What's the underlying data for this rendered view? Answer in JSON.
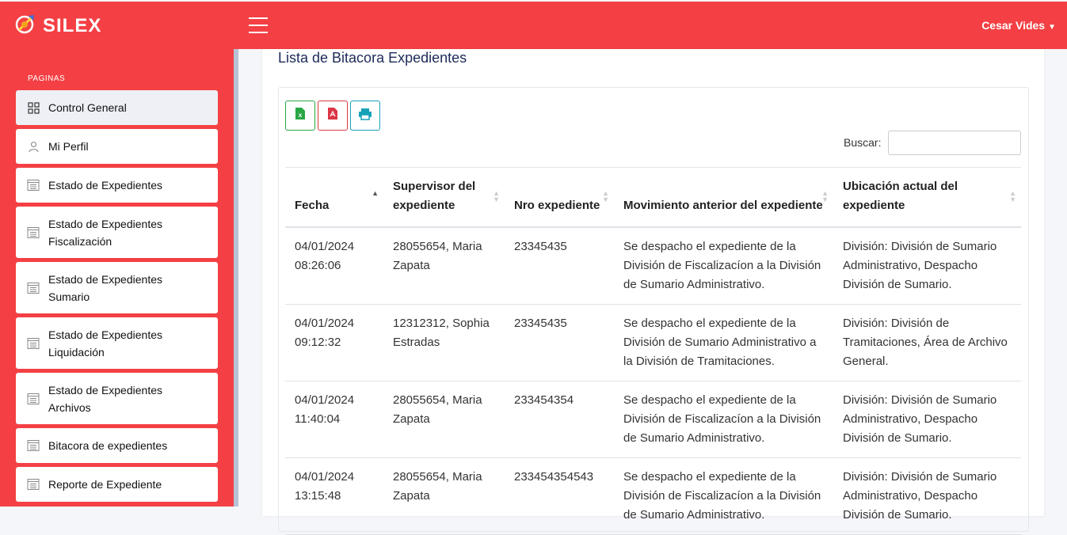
{
  "brand": {
    "name": "SILEX"
  },
  "user": {
    "name": "Cesar Vides"
  },
  "sidebar": {
    "section": "PAGINAS",
    "items": [
      {
        "label": "Control General",
        "icon": "grid-icon"
      },
      {
        "label": "Mi Perfil",
        "icon": "user-icon"
      },
      {
        "label": "Estado de Expedientes",
        "icon": "list-icon"
      },
      {
        "label": "Estado de Expedientes Fiscalización",
        "icon": "list-icon"
      },
      {
        "label": "Estado de Expedientes Sumario",
        "icon": "list-icon"
      },
      {
        "label": "Estado de Expedientes Liquidación",
        "icon": "list-icon"
      },
      {
        "label": "Estado de Expedientes Archivos",
        "icon": "list-icon"
      },
      {
        "label": "Bitacora de expedientes",
        "icon": "list-icon"
      },
      {
        "label": "Reporte de Expediente",
        "icon": "list-icon"
      }
    ]
  },
  "main": {
    "title": "Lista de Bitacora Expedientes",
    "search_label": "Buscar:",
    "search_value": "",
    "export_buttons": [
      {
        "name": "excel-export",
        "icon": "excel-icon",
        "color": "#28a745"
      },
      {
        "name": "pdf-export",
        "icon": "pdf-icon",
        "color": "#dc3545"
      },
      {
        "name": "print-export",
        "icon": "printer-icon",
        "color": "#17a2b8"
      }
    ],
    "table": {
      "columns": [
        "Fecha",
        "Supervisor del expediente",
        "Nro expediente",
        "Movimiento anterior del expediente",
        "Ubicación actual del expediente"
      ],
      "sorted_column": "Fecha",
      "rows": [
        [
          "04/01/2024 08:26:06",
          "28055654, Maria Zapata",
          "23345435",
          "Se despacho el expediente de la División de Fiscalizacíon a la División de Sumario Administrativo.",
          "División: División de Sumario Administrativo, Despacho División de Sumario."
        ],
        [
          "04/01/2024 09:12:32",
          "12312312, Sophia Estradas",
          "23345435",
          "Se despacho el expediente de la División de Sumario Administrativo a la División de Tramitaciones.",
          "División: División de Tramitaciones, Área de Archivo General."
        ],
        [
          "04/01/2024 11:40:04",
          "28055654, Maria Zapata",
          "233454354",
          "Se despacho el expediente de la División de Fiscalizacíon a la División de Sumario Administrativo.",
          "División: División de Sumario Administrativo, Despacho División de Sumario."
        ],
        [
          "04/01/2024 13:15:48",
          "28055654, Maria Zapata",
          "233454354543",
          "Se despacho el expediente de la División de Fiscalizacíon a la División de Sumario Administrativo.",
          "División: División de Sumario Administrativo, Despacho División de Sumario."
        ]
      ]
    }
  },
  "colors": {
    "brand_red": "#f44044",
    "title_navy": "#1d2b59"
  }
}
